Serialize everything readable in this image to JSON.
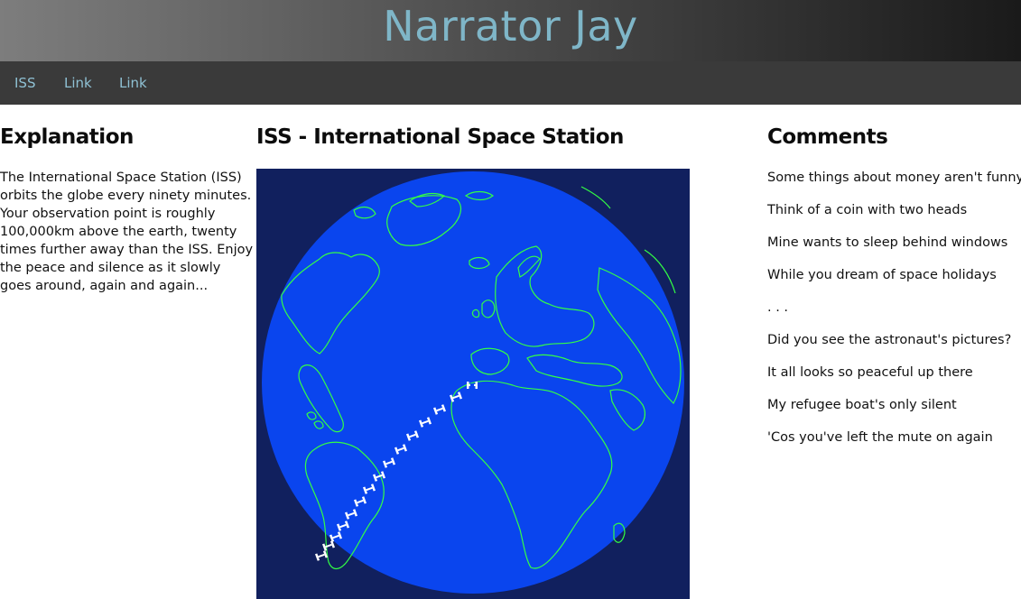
{
  "site": {
    "title": "Narrator Jay"
  },
  "nav": {
    "items": [
      {
        "label": "ISS"
      },
      {
        "label": "Link"
      },
      {
        "label": "Link"
      }
    ]
  },
  "explanation": {
    "heading": "Explanation",
    "text": "The International Space Station (ISS) orbits the globe every ninety minutes. Your observation point is roughly 100,000km above the earth, twenty times further away than the ISS. Enjoy the peace and silence as it slowly goes around, again and again..."
  },
  "iss": {
    "heading": "ISS - International Space Station",
    "colors": {
      "space": "#11205e",
      "ocean": "#0a45ee",
      "coastline": "#33ff44",
      "station": "#ffffff"
    }
  },
  "comments": {
    "heading": "Comments",
    "items": [
      "Some things about money aren't funny",
      "Think of a coin with two heads",
      "Mine wants to sleep behind windows",
      "While you dream of space holidays",
      ". . .",
      "Did you see the astronaut's pictures?",
      "It all looks so peaceful up there",
      "My refugee boat's only silent",
      "'Cos you've left the mute on again"
    ]
  }
}
